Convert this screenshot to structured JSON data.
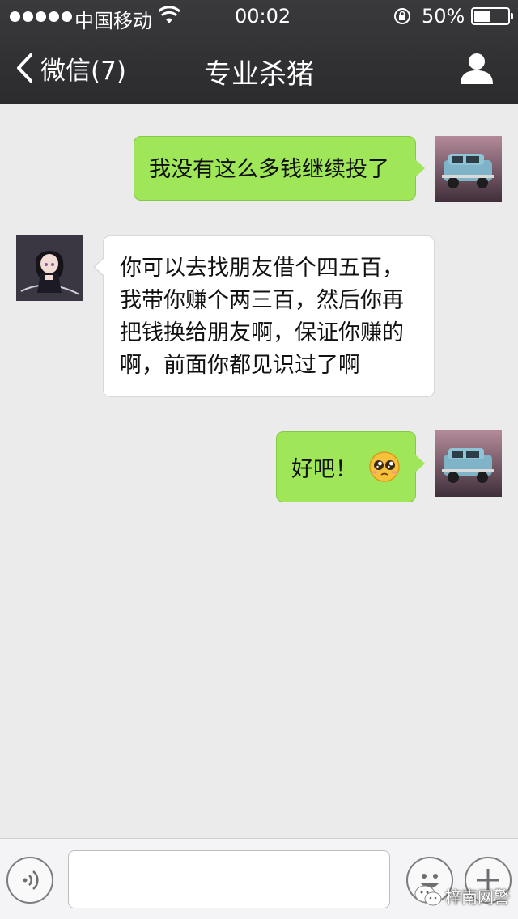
{
  "status_bar": {
    "carrier": "中国移动",
    "time": "00:02",
    "battery_percent": "50%",
    "battery_level": 0.5,
    "signal_bars": 5
  },
  "nav": {
    "back_label": "微信(7)",
    "title": "专业杀猪"
  },
  "messages": [
    {
      "sender": "me",
      "text": "我没有这么多钱继续投了",
      "avatar": "car-avatar"
    },
    {
      "sender": "other",
      "lines": [
        "你可以去找朋友借个四五百，",
        "我带你赚个两三百，然后你再",
        "把钱换给朋友啊，保证你赚的",
        "啊，前面你都见识过了啊"
      ],
      "avatar": "anime-girl-avatar"
    },
    {
      "sender": "me",
      "text": "好吧！",
      "emoji": "pleading-face-emoji",
      "avatar": "car-avatar"
    }
  ],
  "input_bar": {
    "text_value": "",
    "icons": [
      "voice-icon",
      "emoji-face-icon",
      "plus-icon"
    ]
  },
  "watermark": {
    "text": "梓南网警"
  },
  "colors": {
    "nav_background": "#2e2e31",
    "chat_background": "#ebebeb",
    "my_bubble": "#9fe658",
    "their_bubble": "#ffffff"
  }
}
